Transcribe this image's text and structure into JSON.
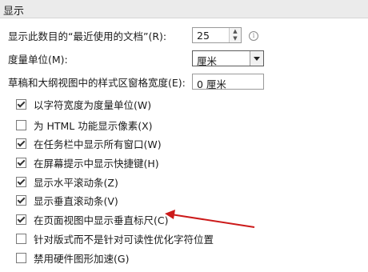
{
  "section": {
    "title": "显示"
  },
  "recent_docs": {
    "label": "显示此数目的“最近使用的文档”(R):",
    "value": "25"
  },
  "units": {
    "label": "度量单位(M):",
    "value": "厘米"
  },
  "style_area": {
    "label": "草稿和大纲视图中的样式区窗格宽度(E):",
    "value": "0 厘米"
  },
  "checkboxes": [
    {
      "label": "以字符宽度为度量单位(W)",
      "checked": true
    },
    {
      "label": "为 HTML 功能显示像素(X)",
      "checked": false
    },
    {
      "label": "在任务栏中显示所有窗口(W)",
      "checked": true
    },
    {
      "label": "在屏幕提示中显示快捷键(H)",
      "checked": true
    },
    {
      "label": "显示水平滚动条(Z)",
      "checked": true
    },
    {
      "label": "显示垂直滚动条(V)",
      "checked": true
    },
    {
      "label": "在页面视图中显示垂直标尺(C)",
      "checked": true
    },
    {
      "label": "针对版式而不是针对可读性优化字符位置",
      "checked": false
    },
    {
      "label": "禁用硬件图形加速(G)",
      "checked": false
    }
  ],
  "colors": {
    "annotation_arrow": "#cc1a1a",
    "header_bg": "#ebebeb"
  }
}
